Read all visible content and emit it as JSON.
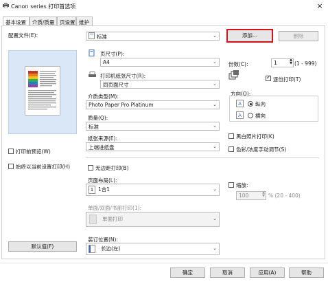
{
  "window": {
    "title": "Canon      series 打印首选项",
    "close": "×"
  },
  "tabs": [
    {
      "label": "基本设置"
    },
    {
      "label": "介质/质量"
    },
    {
      "label": "页设置"
    },
    {
      "label": "维护"
    }
  ],
  "profile": {
    "label": "配置文件(E):",
    "value": "标准",
    "add_button": "添加...",
    "delete_button": "删除"
  },
  "page_size": {
    "label": "页尺寸(P):",
    "value": "A4"
  },
  "printer_paper_size": {
    "label": "打印机纸张尺寸(R):",
    "value": "同页面尺寸"
  },
  "media_type": {
    "label": "介质类型(M):",
    "value": "Photo Paper Pro Platinum"
  },
  "quality": {
    "label": "质量(Q):",
    "value": "标准"
  },
  "paper_source": {
    "label": "纸张来源(E):",
    "value": "上端进纸盘"
  },
  "copies": {
    "label": "份数(C):",
    "value": "1",
    "range": "(1 - 999)"
  },
  "collate": {
    "label": "逐份打印(T)",
    "checked": true
  },
  "orientation": {
    "label": "方向(O):",
    "portrait": "纵向",
    "landscape": "横向"
  },
  "grayscale": {
    "label": "黑白照片打印(K)"
  },
  "manual_color": {
    "label": "色彩/浓度手动调节(S)"
  },
  "preview_before_print": {
    "label": "打印前预览(W)"
  },
  "always_print_current": {
    "label": "始终以当前设置打印(H)"
  },
  "borderless": {
    "label": "无边距打印(B)"
  },
  "page_layout": {
    "label": "页面布局(L):",
    "value": "1合1"
  },
  "scaling": {
    "label": "缩放:",
    "value": "100",
    "range": "% (20 - 400)"
  },
  "duplex": {
    "label": "单面/双面/书册打印(1):",
    "value": "单面打印"
  },
  "binding": {
    "label": "装订位置(N):",
    "value": "长边(左)"
  },
  "defaults_button": "默认值(F)",
  "footer": {
    "ok": "确定",
    "cancel": "取消",
    "apply": "应用(A)",
    "help": "帮助"
  },
  "icons": [
    "printer-icon",
    "page-size-icon",
    "paper-size-icon",
    "copies-icon",
    "portrait-icon",
    "landscape-icon",
    "layout-icon",
    "duplex-icon",
    "binding-icon"
  ],
  "colors": {
    "highlight": "#d0141e",
    "preview_bg": "#d9e7f7"
  }
}
